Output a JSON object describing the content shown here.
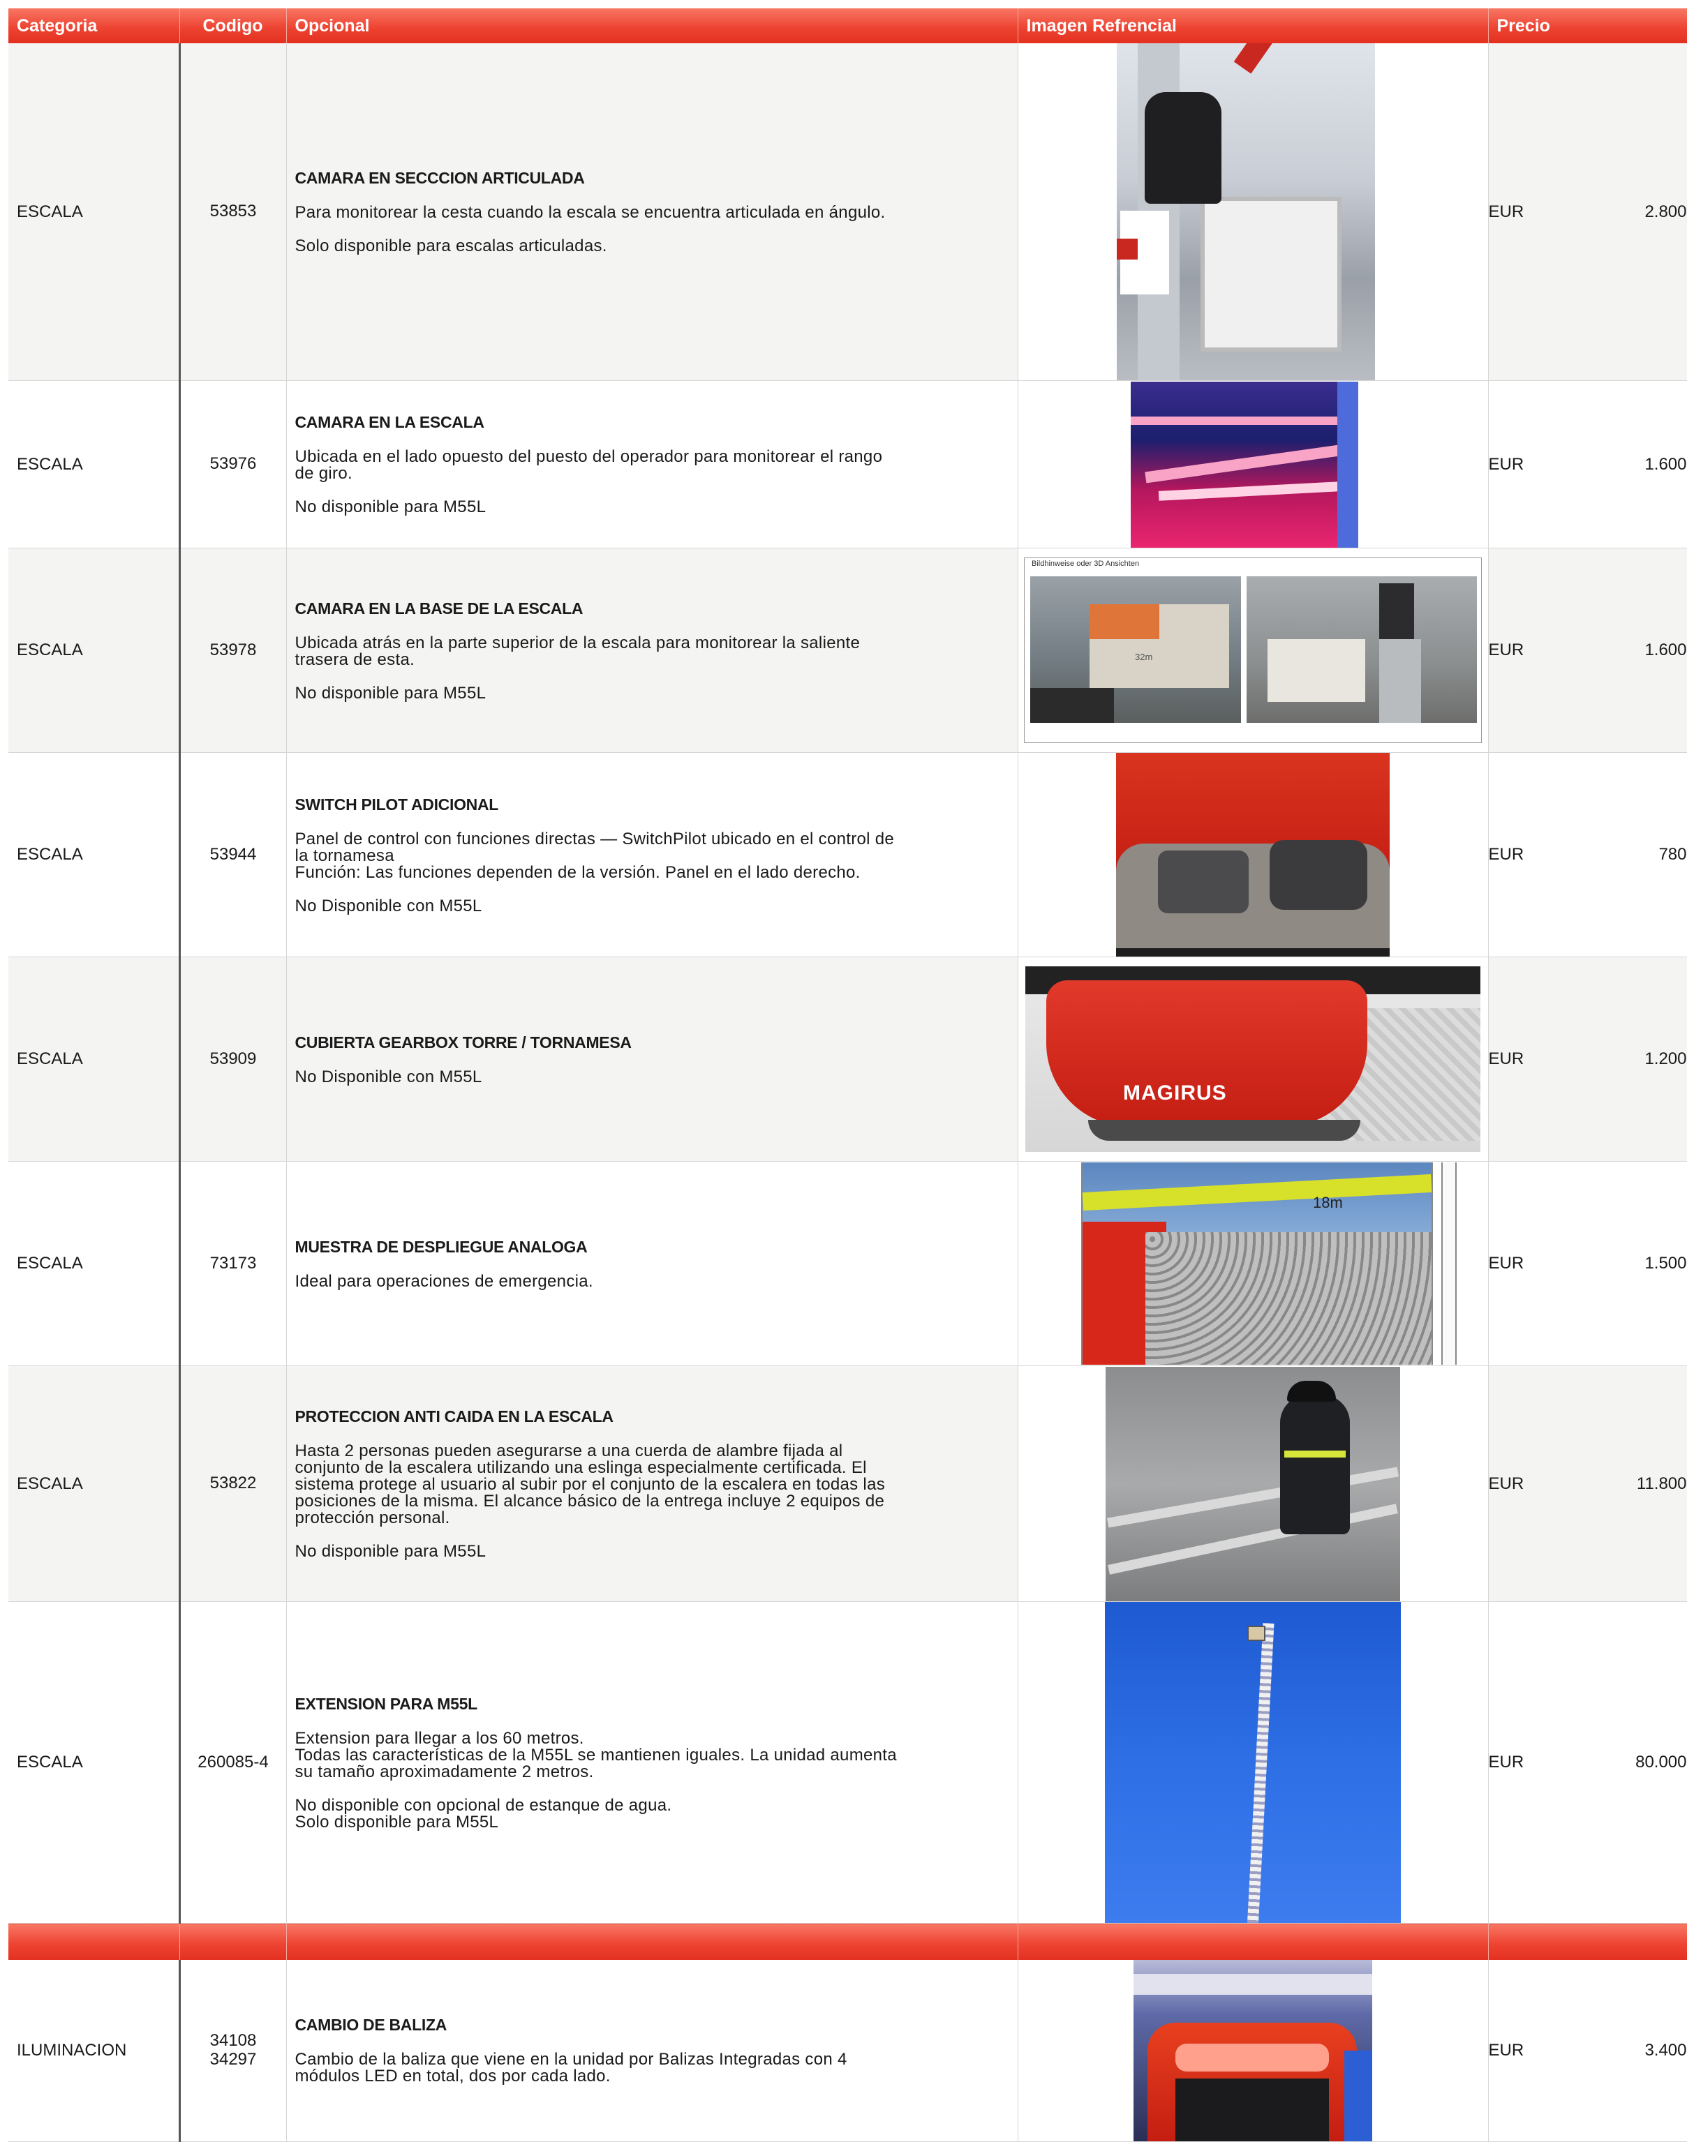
{
  "header": {
    "category": "Categoria",
    "code": "Codigo",
    "optional": "Opcional",
    "image": "Imagen Refrencial",
    "price": "Precio"
  },
  "rows": [
    {
      "category": "ESCALA",
      "code": "53853",
      "title": "CAMARA EN SECCCION ARTICULADA",
      "lines": [
        "Para monitorear la cesta cuando la escala se encuentra articulada en ángulo.",
        "",
        "Solo disponible para escalas articuladas."
      ],
      "currency": "EUR",
      "price": "2.800"
    },
    {
      "category": "ESCALA",
      "code": "53976",
      "title": "CAMARA EN LA ESCALA",
      "lines": [
        "Ubicada en el lado opuesto del puesto del operador para monitorear  el rango",
        "de giro.",
        "",
        "No disponible para M55L"
      ],
      "currency": "EUR",
      "price": "1.600"
    },
    {
      "category": "ESCALA",
      "code": "53978",
      "title": "CAMARA EN LA BASE DE LA ESCALA",
      "lines": [
        "Ubicada atrás en la parte superior de la escala para monitorear la saliente",
        "trasera de esta.",
        "",
        "No disponible para M55L"
      ],
      "currency": "EUR",
      "price": "1.600",
      "image_caption": "Bildhinweise oder 3D Ansichten",
      "image_mark": "32m"
    },
    {
      "category": "ESCALA",
      "code": "53944",
      "title": "SWITCH PILOT ADICIONAL",
      "lines": [
        "Panel de control con funciones directas — SwitchPilot ubicado en el control de",
        "la tornamesa",
        "Función: Las funciones dependen de la versión. Panel en el lado derecho.",
        "",
        "No Disponible con M55L"
      ],
      "currency": "EUR",
      "price": "780"
    },
    {
      "category": "ESCALA",
      "code": "53909",
      "title": "CUBIERTA GEARBOX TORRE / TORNAMESA",
      "lines": [
        "",
        "No Disponible con M55L"
      ],
      "currency": "EUR",
      "price": "1.200",
      "image_logo": "MAGIRUS"
    },
    {
      "category": "ESCALA",
      "code": "73173",
      "title": "MUESTRA DE DESPLIEGUE ANALOGA",
      "lines": [
        "Ideal para operaciones de emergencia."
      ],
      "currency": "EUR",
      "price": "1.500",
      "image_mark": "18m"
    },
    {
      "category": "ESCALA",
      "code": "53822",
      "title": "PROTECCION ANTI CAIDA EN LA ESCALA",
      "lines": [
        "Hasta 2 personas pueden asegurarse a una cuerda de alambre fijada al",
        "conjunto de la escalera utilizando una eslinga especialmente certificada. El",
        "sistema protege al usuario al subir por el conjunto de la escalera en todas las",
        "posiciones de la misma. El alcance básico de la entrega incluye 2 equipos de",
        "protección personal.",
        "",
        "No disponible para M55L"
      ],
      "currency": "EUR",
      "price": "11.800"
    },
    {
      "category": "ESCALA",
      "code": "260085-4",
      "title": "EXTENSION PARA M55L",
      "lines": [
        "Extension para llegar a los 60 metros.",
        "Todas las características de la M55L se mantienen iguales. La unidad aumenta",
        "su tamaño aproximadamente 2 metros.",
        "",
        "No disponible con opcional de estanque de agua.",
        "Solo disponible para M55L"
      ],
      "currency": "EUR",
      "price": "80.000"
    },
    {
      "category": "ILUMINACION",
      "code": "34108\n34297",
      "title": "CAMBIO DE BALIZA",
      "lines": [
        "Cambio de la baliza que viene en la unidad por Balizas Integradas con 4",
        "módulos LED en total, dos por cada lado."
      ],
      "currency": "EUR",
      "price": "3.400"
    }
  ]
}
